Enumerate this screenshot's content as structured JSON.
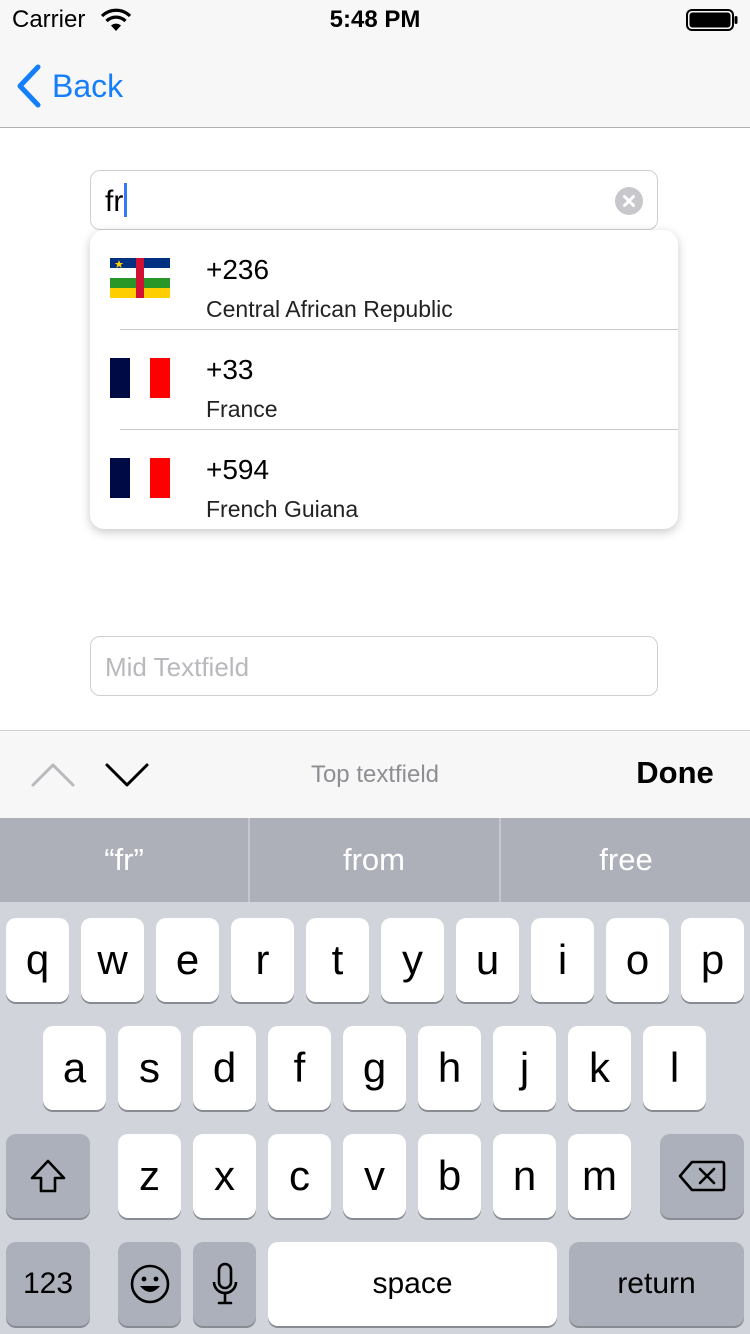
{
  "status_bar": {
    "carrier": "Carrier",
    "time": "5:48 PM"
  },
  "nav": {
    "back_label": "Back"
  },
  "top_field": {
    "value": "fr"
  },
  "dropdown": {
    "items": [
      {
        "code": "+236",
        "name": "Central African Republic"
      },
      {
        "code": "+33",
        "name": "France"
      },
      {
        "code": "+594",
        "name": "French Guiana"
      }
    ]
  },
  "mid_field": {
    "placeholder": "Mid Textfield"
  },
  "toolbar": {
    "title": "Top textfield",
    "done_label": "Done"
  },
  "keyboard": {
    "suggestions": [
      "“fr”",
      "from",
      "free"
    ],
    "row1": [
      "q",
      "w",
      "e",
      "r",
      "t",
      "y",
      "u",
      "i",
      "o",
      "p"
    ],
    "row2": [
      "a",
      "s",
      "d",
      "f",
      "g",
      "h",
      "j",
      "k",
      "l"
    ],
    "row3": [
      "z",
      "x",
      "c",
      "v",
      "b",
      "n",
      "m"
    ],
    "numbers_label": "123",
    "space_label": "space",
    "return_label": "return"
  }
}
